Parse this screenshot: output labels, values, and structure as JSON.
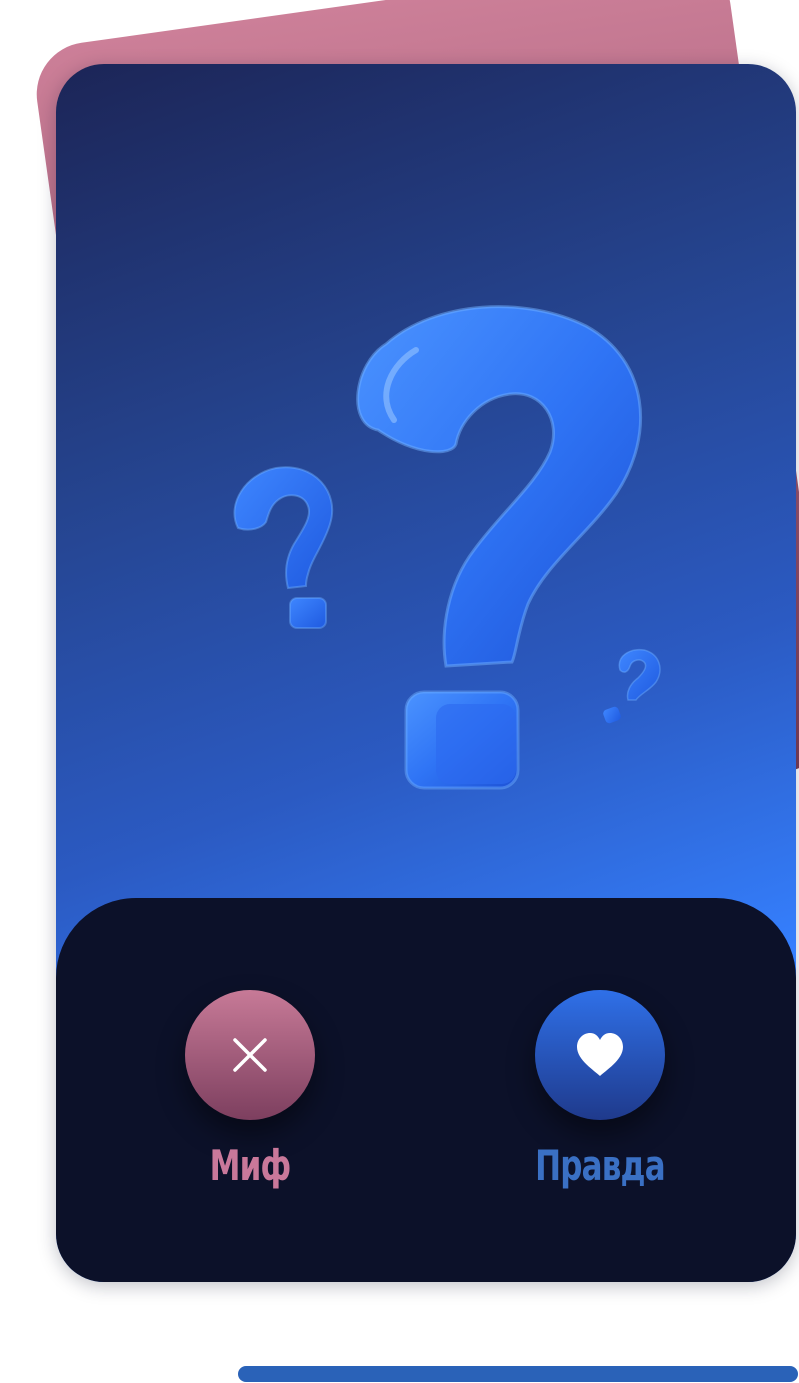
{
  "card": {
    "illustration_icon": "question-marks-icon"
  },
  "actions": {
    "myth": {
      "label": "Миф",
      "icon": "close-icon",
      "color": "#c9789a"
    },
    "truth": {
      "label": "Правда",
      "icon": "heart-icon",
      "color": "#3a70c4"
    }
  },
  "progress": {
    "fill_fraction": 0.7,
    "color": "#2a62b8"
  }
}
